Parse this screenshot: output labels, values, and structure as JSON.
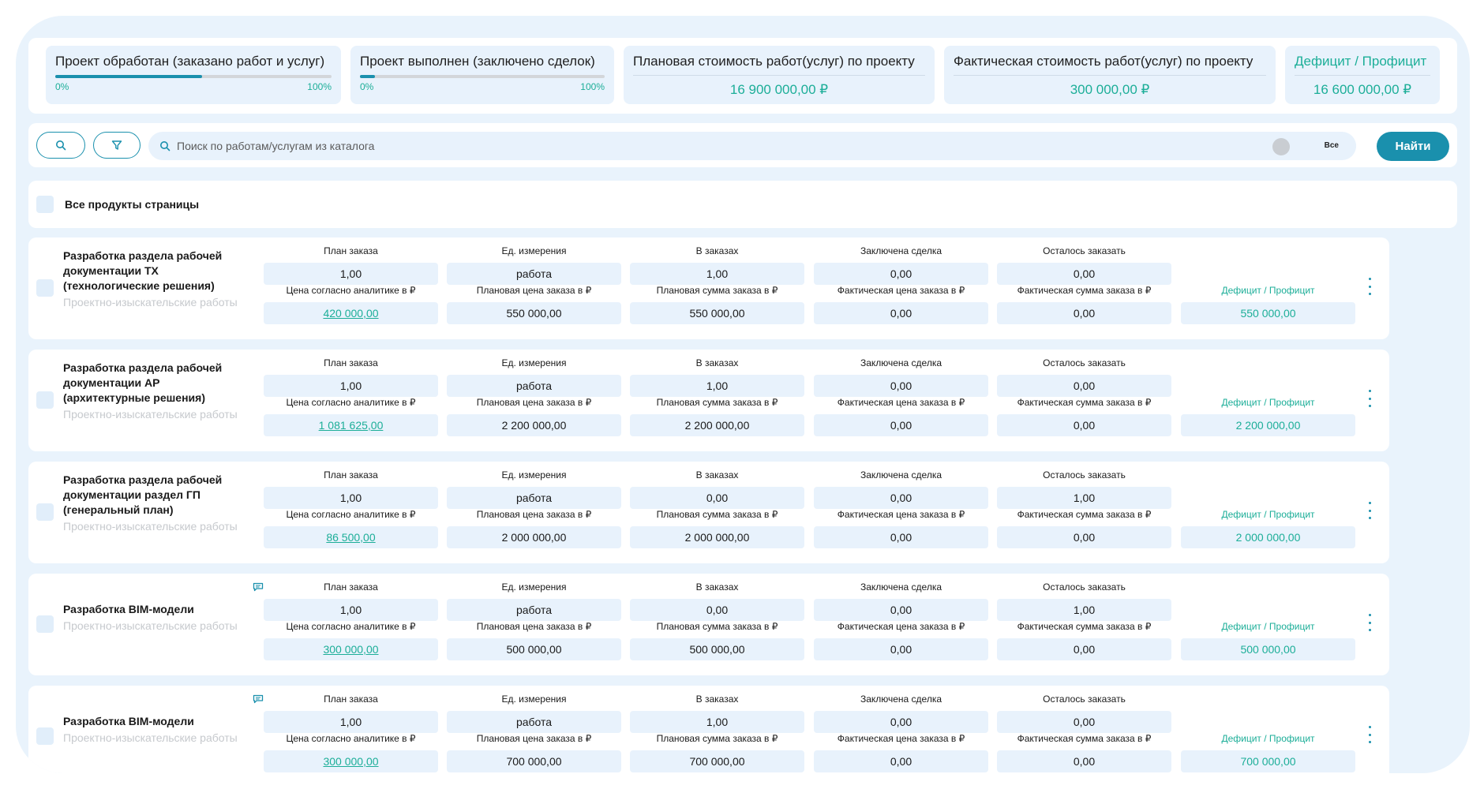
{
  "summary": {
    "processed": {
      "label": "Проект обработан (заказано работ и услуг)",
      "min": "0%",
      "max": "100%",
      "progress": 0.53
    },
    "completed": {
      "label": "Проект выполнен (заключено сделок)",
      "min": "0%",
      "max": "100%",
      "progress": 0.06
    },
    "planned_cost": {
      "label": "Плановая стоимость работ(услуг) по проекту",
      "value": "16 900 000,00 ₽"
    },
    "actual_cost": {
      "label": "Фактическая стоимость работ(услуг) по проекту",
      "value": "300 000,00 ₽"
    },
    "deficit": {
      "label": "Дефицит / Профицит",
      "value": "16 600 000,00 ₽"
    }
  },
  "search": {
    "placeholder": "Поиск по работам/услугам из каталога",
    "toggle_label": "Все",
    "find_label": "Найти"
  },
  "select_all_label": "Все продукты страницы",
  "headers": {
    "plan": "План заказа",
    "unit": "Ед. измерения",
    "in_orders": "В заказах",
    "deal": "Заключена сделка",
    "left": "Осталось заказать",
    "analytics_price": "Цена согласно аналитике в ₽",
    "plan_price": "Плановая цена заказа в ₽",
    "plan_sum": "Плановая сумма заказа в ₽",
    "fact_price": "Фактическая цена заказа в ₽",
    "fact_sum": "Фактическая сумма заказа в ₽",
    "deficit": "Дефицит / Профицит"
  },
  "items": [
    {
      "name": "Разработка раздела рабочей документации ТХ (технологические решения)",
      "category": "Проектно-изыскательские работы",
      "has_comment": false,
      "plan": "1,00",
      "unit": "работа",
      "in_orders": "1,00",
      "deal": "0,00",
      "left": "0,00",
      "analytics_price": "420 000,00 ",
      "plan_price": "550 000,00",
      "plan_sum": "550 000,00",
      "fact_price": "0,00",
      "fact_sum": "0,00",
      "deficit": "550 000,00"
    },
    {
      "name": "Разработка раздела рабочей документации АР (архитектурные решения)",
      "category": "Проектно-изыскательские работы",
      "has_comment": false,
      "plan": "1,00",
      "unit": "работа",
      "in_orders": "1,00",
      "deal": "0,00",
      "left": "0,00",
      "analytics_price": "1 081 625,00 ",
      "plan_price": "2 200 000,00",
      "plan_sum": "2 200 000,00",
      "fact_price": "0,00",
      "fact_sum": "0,00",
      "deficit": "2 200 000,00"
    },
    {
      "name": "Разработка раздела рабочей документации раздел ГП (генеральный план)",
      "category": "Проектно-изыскательские работы",
      "has_comment": false,
      "plan": "1,00",
      "unit": "работа",
      "in_orders": "0,00",
      "deal": "0,00",
      "left": "1,00",
      "analytics_price": "86 500,00 ",
      "plan_price": "2 000 000,00",
      "plan_sum": "2 000 000,00",
      "fact_price": "0,00",
      "fact_sum": "0,00",
      "deficit": "2 000 000,00"
    },
    {
      "name": "Разработка BIM-модели",
      "category": "Проектно-изыскательские работы",
      "has_comment": true,
      "plan": "1,00",
      "unit": "работа",
      "in_orders": "0,00",
      "deal": "0,00",
      "left": "1,00",
      "analytics_price": "300 000,00 ",
      "plan_price": "500 000,00",
      "plan_sum": "500 000,00",
      "fact_price": "0,00",
      "fact_sum": "0,00",
      "deficit": "500 000,00"
    },
    {
      "name": "Разработка BIM-модели",
      "category": "Проектно-изыскательские работы",
      "has_comment": true,
      "plan": "1,00",
      "unit": "работа",
      "in_orders": "1,00",
      "deal": "0,00",
      "left": "0,00",
      "analytics_price": "300 000,00 ",
      "plan_price": "700 000,00",
      "plan_sum": "700 000,00",
      "fact_price": "0,00",
      "fact_sum": "0,00",
      "deficit": "700 000,00"
    }
  ]
}
